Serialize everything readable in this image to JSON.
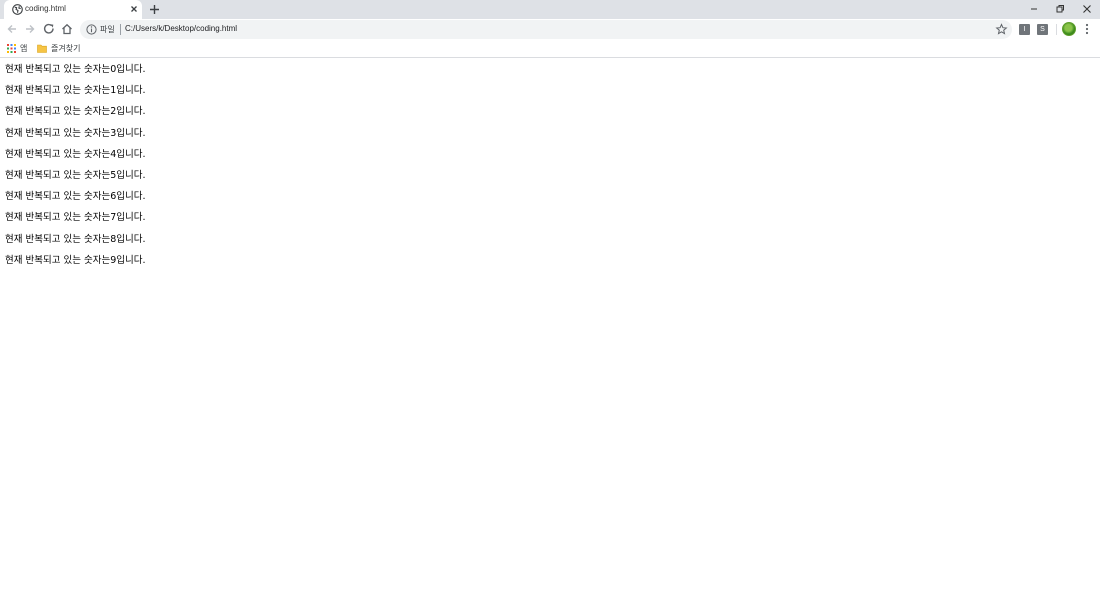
{
  "tab": {
    "title": "coding.html"
  },
  "address_bar": {
    "chip_label": "파일",
    "url": "C:/Users/k/Desktop/coding.html"
  },
  "extensions": [
    {
      "label": "I"
    },
    {
      "label": "S"
    }
  ],
  "bookmarks": {
    "apps_label": "앱",
    "favorites_label": "즐겨찾기"
  },
  "page": {
    "lines": [
      "현재 반복되고 있는 숫자는0입니다.",
      "현재 반복되고 있는 숫자는1입니다.",
      "현재 반복되고 있는 숫자는2입니다.",
      "현재 반복되고 있는 숫자는3입니다.",
      "현재 반복되고 있는 숫자는4입니다.",
      "현재 반복되고 있는 숫자는5입니다.",
      "현재 반복되고 있는 숫자는6입니다.",
      "현재 반복되고 있는 숫자는7입니다.",
      "현재 반복되고 있는 숫자는8입니다.",
      "현재 반복되고 있는 숫자는9입니다."
    ]
  },
  "colors": {
    "tabstrip": "#dee1e6",
    "omnibox": "#f1f3f4",
    "icon": "#5f6368",
    "folder": "#f6c445"
  }
}
